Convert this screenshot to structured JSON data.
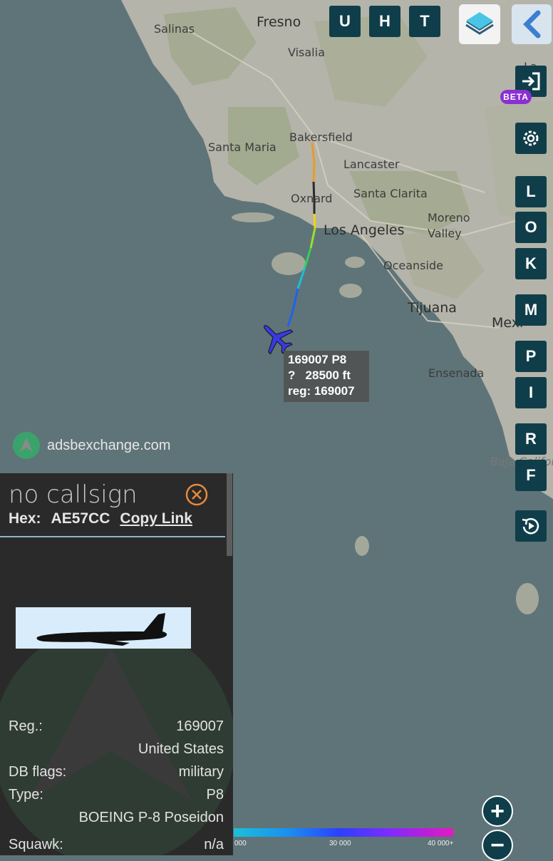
{
  "map": {
    "cities": [
      {
        "name": "Salinas"
      },
      {
        "name": "Fresno"
      },
      {
        "name": "Visalia"
      },
      {
        "name": "Bakersfield"
      },
      {
        "name": "Santa Maria"
      },
      {
        "name": "Lancaster"
      },
      {
        "name": "Oxnard"
      },
      {
        "name": "Santa Clarita"
      },
      {
        "name": "Los Angeles"
      },
      {
        "name": "Moreno"
      },
      {
        "name": "Valley"
      },
      {
        "name": "Oceanside"
      },
      {
        "name": "Tijuana"
      },
      {
        "name": "Mexi"
      },
      {
        "name": "Ensenada"
      },
      {
        "name": "Baja Califor"
      },
      {
        "name": "La"
      }
    ]
  },
  "toolbar": {
    "top_buttons": [
      "U",
      "H",
      "T"
    ],
    "side_buttons": [
      "L",
      "O",
      "K",
      "M",
      "P",
      "I",
      "R",
      "F"
    ],
    "beta_label": "BETA"
  },
  "plane_label": {
    "line1": "169007 P8",
    "line2": "?   28500 ft",
    "line3": "reg: 169007"
  },
  "watermark": "adsbexchange.com",
  "panel": {
    "callsign": "no callsign",
    "hex_label": "Hex:",
    "hex_value": "AE57CC",
    "copy_link": "Copy Link",
    "rows": [
      {
        "key": "Reg.:",
        "value": "169007"
      },
      {
        "key": "",
        "value": "United States"
      },
      {
        "key": "DB flags:",
        "value": "military"
      },
      {
        "key": "Type:",
        "value": "P8"
      },
      {
        "key": "",
        "value": "BOEING P-8 Poseidon"
      },
      {
        "key": "Squawk:",
        "value": "n/a"
      }
    ]
  },
  "altitude_legend": {
    "ticks": [
      "000",
      "30 000",
      "40 000+"
    ]
  },
  "zoom": {
    "in": "+",
    "out": "−"
  },
  "colors": {
    "button_bg": "#0f3e4a",
    "sea": "#5f7478",
    "land": "#b4b3a8",
    "panel_bg": "#2a2a2a",
    "beta": "#8a2fd1",
    "plane": "#3a3ae0"
  }
}
